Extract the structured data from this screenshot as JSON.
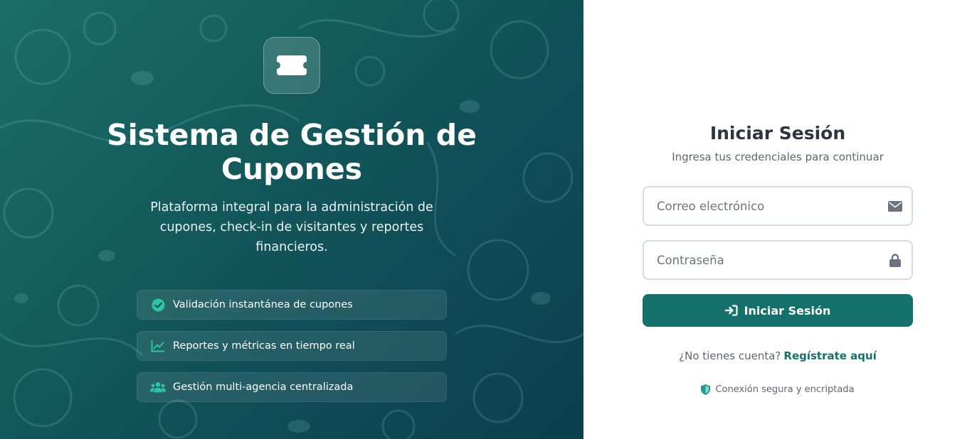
{
  "hero": {
    "logo_icon": "ticket-icon",
    "title": "Sistema de Gestión de Cupones",
    "subtitle": "Plataforma integral para la administración de cupones, check-in de visitantes y reportes financieros.",
    "features": [
      {
        "icon": "check-circle-icon",
        "label": "Validación instantánea de cupones"
      },
      {
        "icon": "chart-line-icon",
        "label": "Reportes y métricas en tiempo real"
      },
      {
        "icon": "users-icon",
        "label": "Gestión multi-agencia centralizada"
      }
    ]
  },
  "login": {
    "title": "Iniciar Sesión",
    "subtitle": "Ingresa tus credenciales para continuar",
    "email": {
      "placeholder": "Correo electrónico",
      "value": "",
      "icon": "envelope-icon"
    },
    "password": {
      "placeholder": "Contraseña",
      "value": "",
      "icon": "lock-icon"
    },
    "submit_label": "Iniciar Sesión",
    "submit_icon": "sign-in-icon",
    "register_prompt": "¿No tienes cuenta?",
    "register_link": "Regístrate aquí",
    "secure_note": "Conexión segura y encriptada",
    "secure_icon": "shield-icon"
  },
  "colors": {
    "accent": "#14706a",
    "hero_gradient_start": "#1b6e6a",
    "hero_gradient_end": "#0d3f4d",
    "feature_icon": "#2ec4a5"
  }
}
